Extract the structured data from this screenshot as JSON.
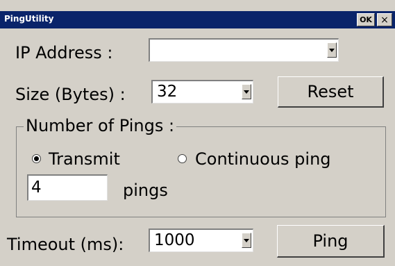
{
  "window": {
    "title": "PingUtility",
    "ok_label": "OK",
    "close_label": "×"
  },
  "ip_address": {
    "label": "IP Address :",
    "value": ""
  },
  "size": {
    "label": "Size (Bytes) :",
    "value": "32"
  },
  "reset_label": "Reset",
  "pings_group": {
    "label": "Number of Pings :",
    "transmit_label": "Transmit",
    "transmit_selected": true,
    "continuous_label": "Continuous ping",
    "continuous_selected": false,
    "count_value": "4",
    "count_suffix": "pings"
  },
  "timeout": {
    "label": "Timeout (ms):",
    "value": "1000"
  },
  "ping_label": "Ping",
  "icons": {
    "dropdown": "chevron-down-icon",
    "close": "close-icon"
  },
  "colors": {
    "titlebar": "#0a246a",
    "face": "#d4d0c8"
  }
}
